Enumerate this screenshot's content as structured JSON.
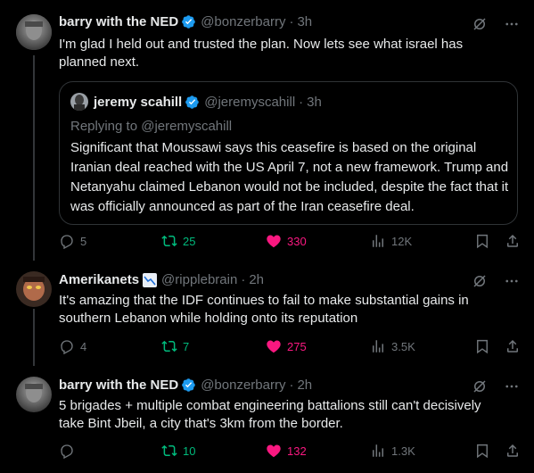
{
  "colors": {
    "background": "#000000",
    "text": "#e7e9ea",
    "muted": "#71767b",
    "retweet": "#00ba7c",
    "like": "#f91880",
    "verified": "#1d9bf0"
  },
  "tweets": [
    {
      "name": "barry with the NED",
      "handle": "@bonzerbarry",
      "time": "3h",
      "text": "I'm glad I held out and trusted the plan. Now lets see what israel has planned next.",
      "quote": {
        "name": "jeremy scahill",
        "handle": "@jeremyscahill",
        "time": "3h",
        "replying_to": "Replying to @jeremyscahill",
        "text": "Significant that Moussawi says this ceasefire is based on the original Iranian deal reached with the US April 7, not a new framework. Trump and Netanyahu claimed Lebanon would not be included, despite the fact that it was officially announced as part of the Iran ceasefire deal."
      },
      "replies": "5",
      "retweets": "25",
      "likes": "330",
      "views": "12K"
    },
    {
      "name": "Amerikanets",
      "handle": "@ripplebrain",
      "time": "2h",
      "text": "It's amazing that the IDF continues to fail to make substantial gains in southern Lebanon while holding onto its reputation",
      "replies": "4",
      "retweets": "7",
      "likes": "275",
      "views": "3.5K"
    },
    {
      "name": "barry with the NED",
      "handle": "@bonzerbarry",
      "time": "2h",
      "text": "5 brigades + multiple combat engineering battalions still can't decisively take Bint Jbeil, a city that's 3km from the border.",
      "replies": "",
      "retweets": "10",
      "likes": "132",
      "views": "1.3K"
    }
  ],
  "separator": "·"
}
